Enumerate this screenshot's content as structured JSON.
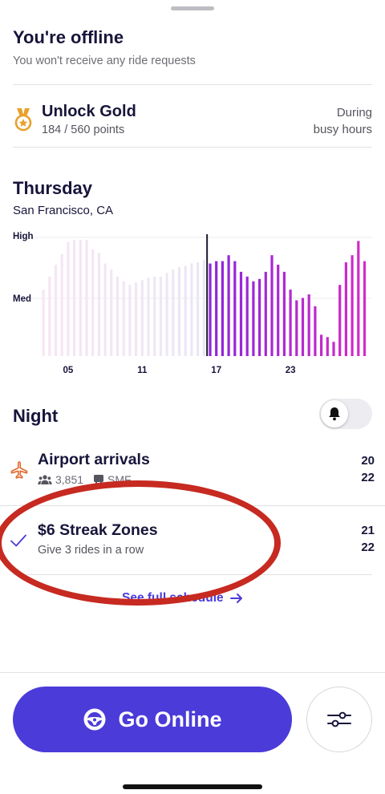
{
  "status": {
    "title": "You're offline",
    "subtitle": "You won't receive any ride requests"
  },
  "gold": {
    "icon": "medal-icon",
    "title": "Unlock Gold",
    "points": "184 / 560 points",
    "note_line1": "During",
    "note_line2": "busy hours"
  },
  "forecast": {
    "day": "Thursday",
    "city": "San Francisco, CA"
  },
  "chart_data": {
    "type": "bar",
    "y_levels": [
      "High",
      "Med"
    ],
    "x_tick_labels": [
      "05",
      "11",
      "17",
      "23"
    ],
    "x_tick_hours": [
      5,
      11,
      17,
      23
    ],
    "hour_start": 3,
    "bars_per_hour": 2,
    "current_index": 27,
    "values": [
      0.56,
      0.67,
      0.77,
      0.86,
      0.96,
      0.98,
      0.98,
      0.98,
      0.9,
      0.87,
      0.78,
      0.73,
      0.67,
      0.63,
      0.6,
      0.62,
      0.64,
      0.66,
      0.67,
      0.67,
      0.7,
      0.73,
      0.75,
      0.76,
      0.78,
      0.79,
      0.81,
      0.78,
      0.8,
      0.8,
      0.85,
      0.8,
      0.71,
      0.67,
      0.63,
      0.65,
      0.71,
      0.85,
      0.77,
      0.71,
      0.56,
      0.47,
      0.49,
      0.52,
      0.42,
      0.18,
      0.16,
      0.12,
      0.6,
      0.79,
      0.85,
      0.97,
      0.8
    ],
    "colors": {
      "past_light": "#f6e6f3",
      "past_right": "#ebe7f5",
      "future_left": "#8c26dd",
      "future_right": "#d52bc6",
      "now_line": "#1a1a2e"
    }
  },
  "night": {
    "label": "Night",
    "toggle_icon": "bell-icon"
  },
  "items": [
    {
      "title": "Airport arrivals",
      "icon": "airplane-icon",
      "meta_count": "3,851",
      "meta_airport": "SMF",
      "num_top": "20",
      "num_bottom": "22"
    },
    {
      "title": "$6 Streak Zones",
      "subtitle": "Give 3 rides in a row",
      "icon": "checkmark-icon",
      "num_top": "21",
      "num_bottom": "22"
    }
  ],
  "schedule_link": "See full schedule",
  "go_online": "Go Online",
  "colors": {
    "primary": "#4b3bd9",
    "annotation": "#c62a21",
    "gold": "#e8a02b",
    "airplane": "#e06a2c"
  }
}
